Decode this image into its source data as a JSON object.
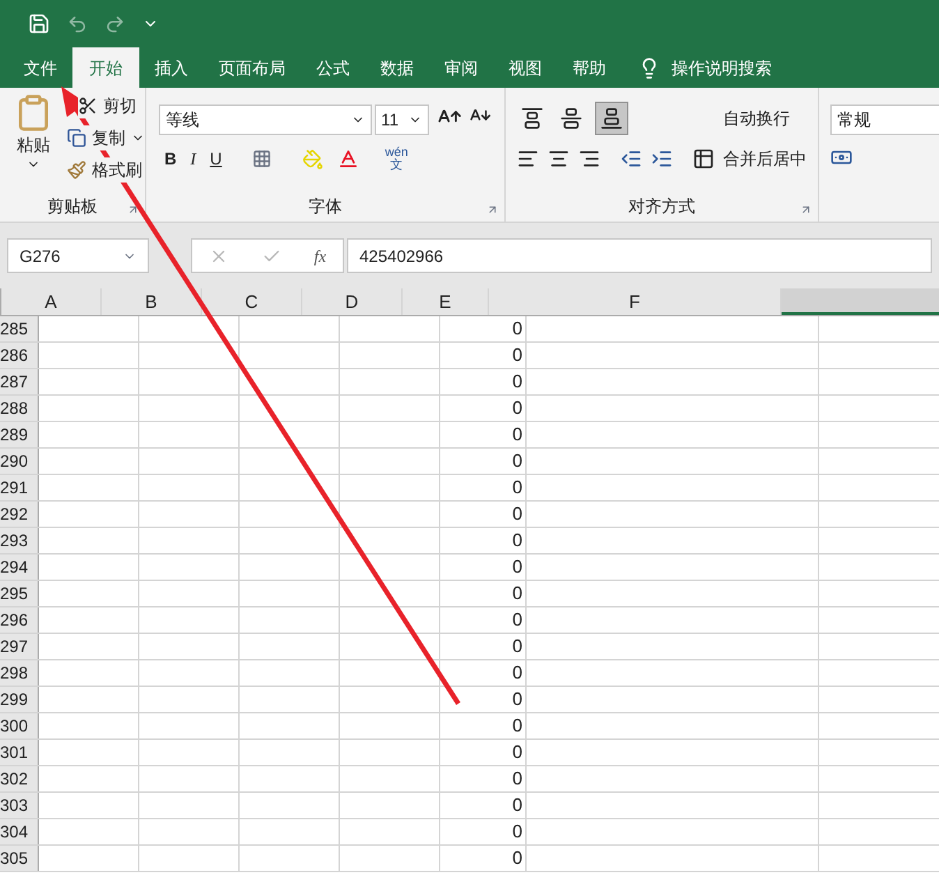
{
  "menu_tabs": [
    {
      "label": "文件",
      "selected": false
    },
    {
      "label": "开始",
      "selected": true
    },
    {
      "label": "插入",
      "selected": false
    },
    {
      "label": "页面布局",
      "selected": false
    },
    {
      "label": "公式",
      "selected": false
    },
    {
      "label": "数据",
      "selected": false
    },
    {
      "label": "审阅",
      "selected": false
    },
    {
      "label": "视图",
      "selected": false
    },
    {
      "label": "帮助",
      "selected": false
    }
  ],
  "tell_me": "操作说明搜索",
  "ribbon": {
    "clipboard": {
      "paste": "粘贴",
      "cut": "剪切",
      "copy": "复制",
      "format_painter": "格式刷",
      "label": "剪贴板"
    },
    "font": {
      "name": "等线",
      "size": "11",
      "bold": "B",
      "italic": "I",
      "underline": "U",
      "phonetic_top": "wén",
      "phonetic_bottom": "文",
      "label": "字体"
    },
    "alignment": {
      "vertical_align": [
        {
          "selected": false
        },
        {
          "selected": false
        },
        {
          "selected": true
        }
      ],
      "wrap": "自动换行",
      "merge": "合并后居中",
      "label": "对齐方式"
    },
    "number": {
      "format": "常规"
    }
  },
  "formula_bar": {
    "name_box": "G276",
    "fx": "fx",
    "value": "425402966"
  },
  "sheet": {
    "columns": [
      {
        "label": "A",
        "selected": false
      },
      {
        "label": "B",
        "selected": false
      },
      {
        "label": "C",
        "selected": false
      },
      {
        "label": "D",
        "selected": false
      },
      {
        "label": "E",
        "selected": false
      },
      {
        "label": "F",
        "selected": false
      },
      {
        "selected": true
      }
    ],
    "rows": [
      {
        "number": "285",
        "e": "0"
      },
      {
        "number": "286",
        "e": "0"
      },
      {
        "number": "287",
        "e": "0"
      },
      {
        "number": "288",
        "e": "0"
      },
      {
        "number": "289",
        "e": "0"
      },
      {
        "number": "290",
        "e": "0"
      },
      {
        "number": "291",
        "e": "0"
      },
      {
        "number": "292",
        "e": "0"
      },
      {
        "number": "293",
        "e": "0"
      },
      {
        "number": "294",
        "e": "0"
      },
      {
        "number": "295",
        "e": "0"
      },
      {
        "number": "296",
        "e": "0"
      },
      {
        "number": "297",
        "e": "0"
      },
      {
        "number": "298",
        "e": "0"
      },
      {
        "number": "299",
        "e": "0"
      },
      {
        "number": "300",
        "e": "0"
      },
      {
        "number": "301",
        "e": "0"
      },
      {
        "number": "302",
        "e": "0"
      },
      {
        "number": "303",
        "e": "0"
      },
      {
        "number": "304",
        "e": "0"
      },
      {
        "number": "305",
        "e": "0"
      }
    ]
  }
}
